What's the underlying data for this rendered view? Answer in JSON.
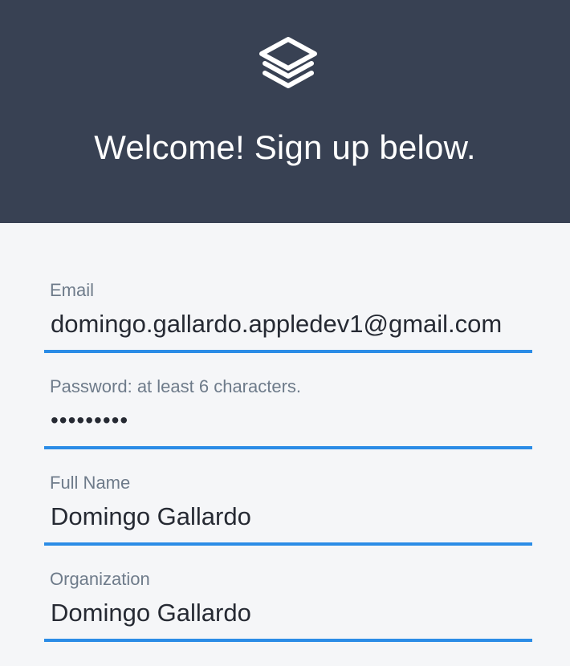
{
  "header": {
    "logo_icon": "stacked-layers-icon",
    "title": "Welcome! Sign up below.",
    "background_color": "#384153"
  },
  "form": {
    "accent_color": "#2b8ce6",
    "fields": [
      {
        "label": "Email",
        "value": "domingo.gallardo.appledev1@gmail.com",
        "type": "email"
      },
      {
        "label": "Password: at least 6 characters.",
        "value": "•••••••••",
        "type": "password"
      },
      {
        "label": "Full Name",
        "value": "Domingo Gallardo",
        "type": "text"
      },
      {
        "label": "Organization",
        "value": "Domingo Gallardo",
        "type": "text"
      }
    ]
  }
}
